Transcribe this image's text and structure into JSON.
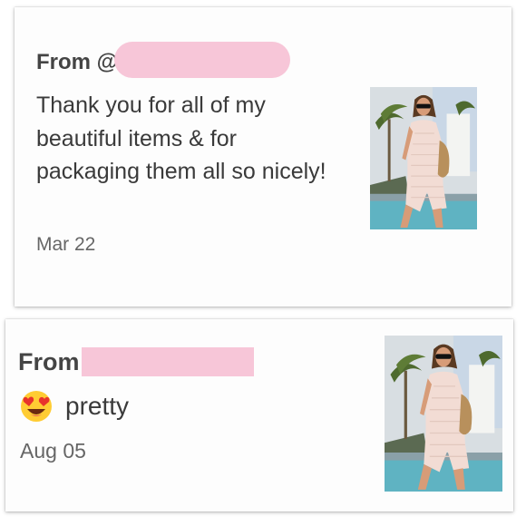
{
  "reviews": [
    {
      "from_label": "From @",
      "message": "Thank you for all of my beautiful items & for packaging them all so nicely!",
      "date": "Mar 22",
      "photo_icon": "product-photo-dress-icon"
    },
    {
      "from_label": "From",
      "emoji_icon": "heart-eyes-emoji-icon",
      "message": "pretty",
      "date": "Aug 05",
      "photo_icon": "product-photo-dress-icon"
    }
  ],
  "colors": {
    "redaction": "#f7c6d8",
    "text": "#3a3a3a",
    "muted": "#666666"
  }
}
